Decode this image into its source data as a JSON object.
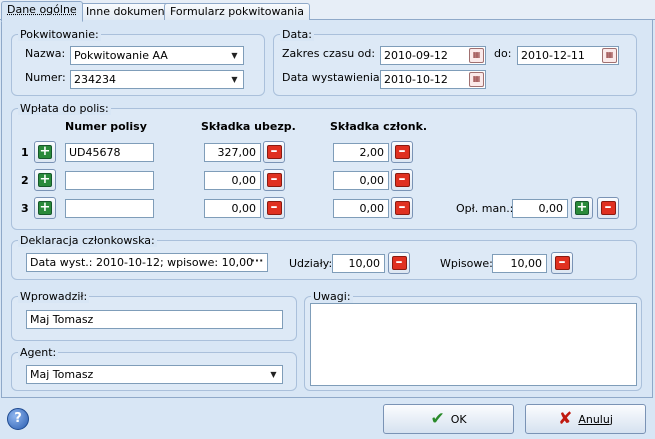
{
  "tabs": [
    {
      "label": "Dane ogólne",
      "active": true
    },
    {
      "label": "Inne dokumenty",
      "active": false
    },
    {
      "label": "Formularz pokwitowania",
      "active": false
    }
  ],
  "pokwitowanie": {
    "group_label": "Pokwitowanie:",
    "nazwa_label": "Nazwa:",
    "nazwa_value": "Pokwitowanie AA",
    "numer_label": "Numer:",
    "numer_value": "234234"
  },
  "data": {
    "group_label": "Data:",
    "zakres_label": "Zakres czasu od:",
    "od_value": "2010-09-12",
    "do_label": "do:",
    "do_value": "2010-12-11",
    "wystawienia_label": "Data wystawienia:",
    "wystawienia_value": "2010-10-12"
  },
  "wplata": {
    "group_label": "Wpłata do polis:",
    "col_polisa": "Numer polisy",
    "col_ubezp": "Składka ubezp.",
    "col_czlonk": "Składka członk.",
    "rows": [
      {
        "num": "1",
        "polisa": "UD45678",
        "ubezp": "327,00",
        "czlonk": "2,00"
      },
      {
        "num": "2",
        "polisa": "",
        "ubezp": "0,00",
        "czlonk": "0,00"
      },
      {
        "num": "3",
        "polisa": "",
        "ubezp": "0,00",
        "czlonk": "0,00"
      }
    ],
    "opl_label": "Opł. man.:",
    "opl_value": "0,00"
  },
  "deklaracja": {
    "group_label": "Deklaracja członkowska:",
    "value": "Data wyst.: 2010-10-12; wpisowe: 10,00",
    "udzialy_label": "Udziały:",
    "udzialy_value": "10,00",
    "wpisowe_label": "Wpisowe:",
    "wpisowe_value": "10,00"
  },
  "wprowadzil": {
    "group_label": "Wprowadził:",
    "value": "Maj Tomasz"
  },
  "agent": {
    "group_label": "Agent:",
    "value": "Maj Tomasz"
  },
  "uwagi": {
    "group_label": "Uwagi:",
    "value": ""
  },
  "buttons": {
    "help": "?",
    "ok": "OK",
    "cancel": "Anuluj"
  },
  "icons": {
    "ok": "check-icon",
    "cancel": "x-icon",
    "help": "help-icon",
    "calendar": "calendar-icon",
    "plus": "plus-icon",
    "minus": "minus-icon",
    "dropdown": "chevron-down-icon"
  },
  "colors": {
    "background": "#d8e6f5",
    "plus_green": "#2a8a3a",
    "minus_red": "#e03020"
  }
}
